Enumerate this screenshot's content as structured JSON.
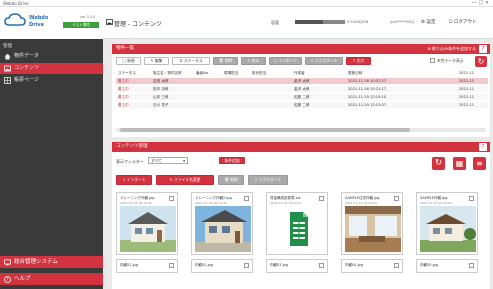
{
  "window": {
    "title": "Webdo Drive",
    "controls": "—  □  ✕"
  },
  "logo": {
    "brand_line1": "Webdo",
    "brand_line2": "Drive",
    "version": "ver.3.3.0",
    "badge": "テスト環境"
  },
  "sidebar": {
    "header": "管理",
    "items": [
      {
        "label": "物件データ",
        "icon": "home-icon"
      },
      {
        "label": "コンテンツ",
        "icon": "image-icon"
      },
      {
        "label": "帳票ページ",
        "icon": "grid-icon"
      }
    ],
    "bottom": [
      {
        "label": "総合管理システム",
        "icon": "system-icon"
      },
      {
        "label": "ヘルプ",
        "icon": "help-icon"
      }
    ]
  },
  "header": {
    "title": "管理 - コンテンツ",
    "capacity_label": "容量",
    "capacity_fraction": 0.55,
    "usage_text": "0.54GB/3GB",
    "user_text": "(pu******001)",
    "settings_label": "設定",
    "logout_label": "ログアウト"
  },
  "property_panel": {
    "title": "物件一覧",
    "register_label": "絞り込み条件を追加する",
    "toolbar": [
      "新規",
      "編集",
      "ステータス",
      "削除",
      "戻る",
      "インポート",
      "エクスポート",
      "出力"
    ],
    "display_all_label": "未完データ表示",
    "columns": [
      "ステータス",
      "施主名・物件名称",
      "番組No.",
      "現場担当",
      "設計担当",
      "作成者",
      "更新日時",
      "2021-11"
    ],
    "rows": [
      [
        "着工中",
        "吉田 太郎",
        "",
        "",
        "",
        "金沢 太郎",
        "2021-11-16 10:37:27",
        "2021-11"
      ],
      [
        "着工中",
        "田中 次郎",
        "",
        "",
        "",
        "金沢 太郎",
        "2021-11-16 15:21:17",
        "2021-11"
      ],
      [
        "着工中",
        "山本 三郎",
        "",
        "",
        "",
        "佐藤 二郎",
        "2021-11-19 12:15:10",
        "2021-11"
      ],
      [
        "着工中",
        "石川 花子",
        "",
        "",
        "",
        "佐藤 二郎",
        "2021-11-19 12:13:07",
        "2021-11"
      ]
    ]
  },
  "content_panel": {
    "title": "コンテンツ管理",
    "filter_label": "表示フィルター",
    "filter_value": "すべて",
    "filter_apply": "条件追加",
    "toolbar": [
      "インポート",
      "ファイル名変更",
      "削除",
      "エクスポート"
    ],
    "thumbs": [
      {
        "name": "ドレーニング外観.jpg",
        "date": "2021-11-05 18:13:45",
        "kind": "house"
      },
      {
        "name": "ドレーニング外観2.jpg",
        "date": "2021-11-05 18:11:45",
        "kind": "house-blue"
      },
      {
        "name": "資金構成試算表.xls",
        "date": "2021-11-04 14:11:47",
        "kind": "excel"
      },
      {
        "name": "SAMPLE住宅外観.jpg",
        "date": "2021-11-11 19:45:59",
        "kind": "interior"
      },
      {
        "name": "SAMPLE外観.jpg",
        "date": "2021-11-13 16:03:03",
        "kind": "house-green"
      }
    ],
    "thumbs_row2": [
      "内観01.jpg",
      "内観02.jpg",
      "内観03.jpg",
      "内観04.jpg",
      "内観05.jpg"
    ]
  }
}
